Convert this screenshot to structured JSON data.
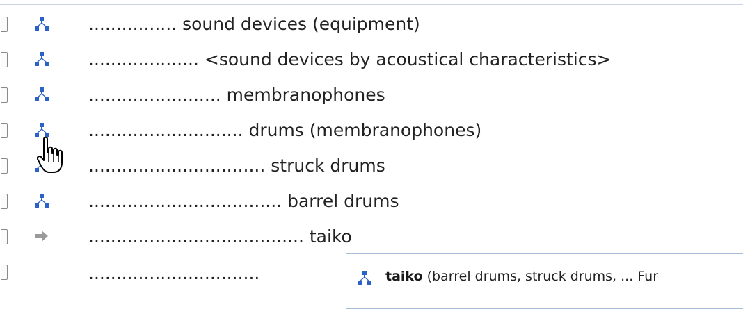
{
  "hierarchy": {
    "rows": [
      {
        "term": "................ sound devices (equipment)",
        "icon": "hierarchy-icon"
      },
      {
        "term": ".................... <sound devices by acoustical characteristics>",
        "icon": "hierarchy-icon"
      },
      {
        "term": "........................ membranophones",
        "icon": "hierarchy-icon"
      },
      {
        "term": "............................ drums (membranophones)",
        "icon": "hierarchy-icon"
      },
      {
        "term": "................................ struck drums",
        "icon": "hierarchy-icon"
      },
      {
        "term": "................................... barrel drums",
        "icon": "hierarchy-icon"
      },
      {
        "term": "....................................... taiko",
        "icon": "arrow-right-icon"
      },
      {
        "term": "...............................",
        "icon": ""
      }
    ]
  },
  "popup": {
    "icon": "hierarchy-icon",
    "title": "taiko",
    "context": " (barrel drums, struck drums, ... Fur"
  },
  "colors": {
    "hierarchy_icon": "#2c62c8",
    "arrow_icon": "#9a9a9a",
    "popup_border": "#a8bdd8"
  }
}
